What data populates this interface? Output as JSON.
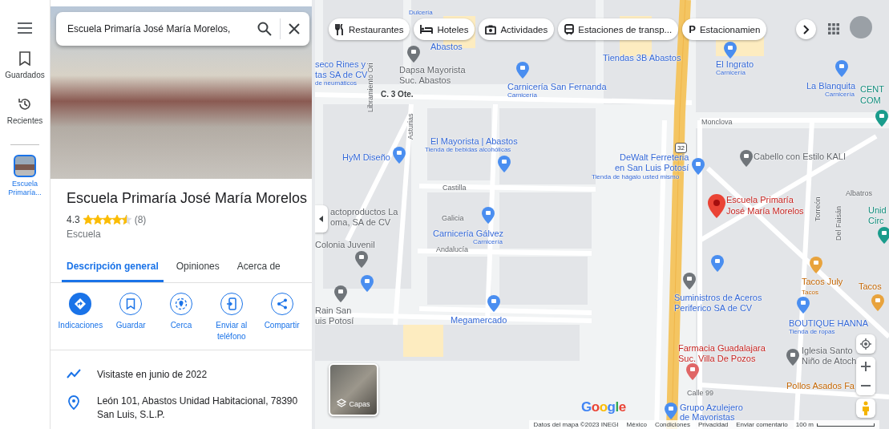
{
  "rail": {
    "items": [
      {
        "label": "Guardados",
        "selected": false
      },
      {
        "label": "Recientes",
        "selected": false
      }
    ],
    "recent_place": {
      "label": "Escuela Primaría...",
      "selected": true
    }
  },
  "search": {
    "value": "Escuela Primaría José María Morelos,"
  },
  "place": {
    "title": "Escuela Primaría José María Morelos",
    "rating": "4.3",
    "stars": 4.5,
    "reviews": "(8)",
    "category": "Escuela"
  },
  "tabs": [
    {
      "label": "Descripción general",
      "selected": true
    },
    {
      "label": "Opiniones",
      "selected": false
    },
    {
      "label": "Acerca de",
      "selected": false
    }
  ],
  "actions": [
    {
      "label": "Indicaciones",
      "kind": "primary"
    },
    {
      "label": "Guardar",
      "kind": "outline"
    },
    {
      "label": "Cerca",
      "kind": "outline"
    },
    {
      "label": "Enviar al teléfono",
      "kind": "outline"
    },
    {
      "label": "Compartir",
      "kind": "outline"
    }
  ],
  "info": [
    {
      "text": "Visitaste en junio de 2022"
    },
    {
      "text": "León 101, Abastos Unidad Habitacional, 78390 San Luis, S.L.P."
    }
  ],
  "chips": [
    {
      "label": "Restaurantes"
    },
    {
      "label": "Hoteles"
    },
    {
      "label": "Actividades"
    },
    {
      "label": "Estaciones de transp..."
    },
    {
      "label": "Estacionamien",
      "glyph": "P"
    }
  ],
  "map": {
    "labels": [
      {
        "text": "Dulcería",
        "kind": "poi_sub"
      },
      {
        "text": "Abastos",
        "kind": "poi"
      },
      {
        "text": "seco Rines y",
        "kind": "poi"
      },
      {
        "text": "tas SA de CV",
        "kind": "poi"
      },
      {
        "text": "de neumáticos",
        "kind": "poi_sub"
      },
      {
        "text": "Dapsa Mayorista",
        "kind": "place"
      },
      {
        "text": "Suc. Abastos",
        "kind": "place"
      },
      {
        "text": "Carnicería San Fernanda",
        "kind": "poi"
      },
      {
        "text": "Carnicería",
        "kind": "poi_sub"
      },
      {
        "text": "Tiendas 3B Abastos",
        "kind": "poi"
      },
      {
        "text": "El Ingrato",
        "kind": "poi"
      },
      {
        "text": "Carnicería",
        "kind": "poi_sub"
      },
      {
        "text": "La Blanquita",
        "kind": "poi"
      },
      {
        "text": "Carnicería",
        "kind": "poi_sub"
      },
      {
        "text": "CENT",
        "kind": "park"
      },
      {
        "text": "COM",
        "kind": "park"
      },
      {
        "text": "C. 3 Ote.",
        "kind": "street_bold"
      },
      {
        "text": "Libramiento Ori",
        "kind": "street_vertical"
      },
      {
        "text": "Monclova",
        "kind": "street"
      },
      {
        "text": "Asturias",
        "kind": "street_vertical"
      },
      {
        "text": "El Mayorista | Abastos",
        "kind": "poi"
      },
      {
        "text": "Tienda de bebidas alcohólicas",
        "kind": "poi_sub"
      },
      {
        "text": "HyM Diseño",
        "kind": "poi"
      },
      {
        "text": "DeWalt Ferreteria",
        "kind": "poi"
      },
      {
        "text": "en San Luis Potosí",
        "kind": "poi"
      },
      {
        "text": "Tienda de hágalo usted mismo",
        "kind": "poi_sub"
      },
      {
        "text": "Cabello con Estilo KALI",
        "kind": "place"
      },
      {
        "text": "Castilla",
        "kind": "street"
      },
      {
        "text": "Galicia",
        "kind": "street"
      },
      {
        "text": "Andalucía",
        "kind": "street"
      },
      {
        "text": "Escuela Primaría",
        "kind": "selected"
      },
      {
        "text": "José María Morelos",
        "kind": "selected"
      },
      {
        "text": "Albatros",
        "kind": "street"
      },
      {
        "text": "Unid",
        "kind": "park"
      },
      {
        "text": "Circ",
        "kind": "park"
      },
      {
        "text": "actoproductos La",
        "kind": "place"
      },
      {
        "text": "oma, SA de CV",
        "kind": "place"
      },
      {
        "text": "Carnicería Gálvez",
        "kind": "poi"
      },
      {
        "text": "Carnicería",
        "kind": "poi_sub"
      },
      {
        "text": "Colonia Juvenil",
        "kind": "place"
      },
      {
        "text": "Torreón",
        "kind": "street_vertical"
      },
      {
        "text": "Del Faisán",
        "kind": "street_vertical"
      },
      {
        "text": "Tacos July",
        "kind": "food"
      },
      {
        "text": "Tacos",
        "kind": "food_sub"
      },
      {
        "text": "Tacos",
        "kind": "food"
      },
      {
        "text": "Rain San",
        "kind": "place"
      },
      {
        "text": "uis Potosí",
        "kind": "place"
      },
      {
        "text": "Suministros de Aceros",
        "kind": "poi"
      },
      {
        "text": "Periferico SA de CV",
        "kind": "poi"
      },
      {
        "text": "Megamercado",
        "kind": "poi"
      },
      {
        "text": "BOUTIQUE HANNA",
        "kind": "poi"
      },
      {
        "text": "Tienda de ropas",
        "kind": "poi_sub"
      },
      {
        "text": "Farmacia Guadalajara",
        "kind": "pharmacy"
      },
      {
        "text": "Suc. Villa De Pozos",
        "kind": "pharmacy"
      },
      {
        "text": "Iglesia Santo",
        "kind": "place"
      },
      {
        "text": "Niño de Atoch",
        "kind": "place"
      },
      {
        "text": "Pollos Asados Fa",
        "kind": "food"
      },
      {
        "text": "Calle 99",
        "kind": "street"
      },
      {
        "text": "Grupo Azulejero",
        "kind": "poi"
      },
      {
        "text": "de Mayoristas",
        "kind": "poi"
      }
    ],
    "route_shield": "32",
    "layers_label": "Capas",
    "logo": "Google",
    "attribution": [
      "Datos del mapa ©2023 INEGI",
      "México",
      "Condiciones",
      "Privacidad",
      "Enviar comentario"
    ],
    "scale": "100 m"
  }
}
